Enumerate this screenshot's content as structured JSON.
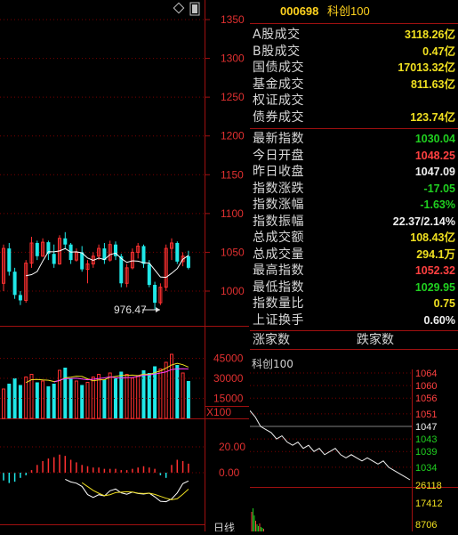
{
  "header": {
    "code": "000698",
    "name": "科创100"
  },
  "stats": [
    {
      "label": "A股成交",
      "value": "3118.26亿",
      "color": "yel"
    },
    {
      "label": "B股成交",
      "value": "0.47亿",
      "color": "yel"
    },
    {
      "label": "国债成交",
      "value": "17013.32亿",
      "color": "yel"
    },
    {
      "label": "基金成交",
      "value": "811.63亿",
      "color": "yel"
    },
    {
      "label": "权证成交",
      "value": "",
      "color": "yel"
    },
    {
      "label": "债券成交",
      "value": "123.74亿",
      "color": "yel"
    }
  ],
  "quote": [
    {
      "label": "最新指数",
      "value": "1030.04",
      "color": "grn"
    },
    {
      "label": "今日开盘",
      "value": "1048.25",
      "color": "red"
    },
    {
      "label": "昨日收盘",
      "value": "1047.09",
      "color": "wht"
    },
    {
      "label": "指数涨跌",
      "value": "-17.05",
      "color": "grn"
    },
    {
      "label": "指数涨幅",
      "value": "-1.63%",
      "color": "grn"
    },
    {
      "label": "指数振幅",
      "value": "22.37/2.14%",
      "color": "wht"
    },
    {
      "label": "总成交额",
      "value": "108.43亿",
      "color": "yel"
    },
    {
      "label": "总成交量",
      "value": "294.1万",
      "color": "yel"
    },
    {
      "label": "最高指数",
      "value": "1052.32",
      "color": "red"
    },
    {
      "label": "最低指数",
      "value": "1029.95",
      "color": "grn"
    },
    {
      "label": "指数量比",
      "value": "0.75",
      "color": "yel"
    },
    {
      "label": "上证换手",
      "value": "0.60%",
      "color": "wht"
    }
  ],
  "updown": {
    "up_label": "涨家数",
    "down_label": "跌家数"
  },
  "mini_chart": {
    "title": "科创100",
    "price_ticks": [
      "1064",
      "1060",
      "1056",
      "1051",
      "1047",
      "1043",
      "1039",
      "1034"
    ],
    "vol_ticks": [
      "26118",
      "17412",
      "8706"
    ]
  },
  "kline": {
    "price_ticks": [
      "1350",
      "1300",
      "1250",
      "1200",
      "1150",
      "1100",
      "1050",
      "1000"
    ],
    "low_label": "976.47",
    "vol_ticks": [
      "45000",
      "30000",
      "15000"
    ],
    "vol_unit": "X100",
    "macd_ticks": [
      "20.00",
      "0.00"
    ],
    "bottom_label": "日线",
    "colors": {
      "up": "#ff3030",
      "down": "#20e8e8",
      "ma5": "#ffffff",
      "ma10": "#f0e020",
      "ma20": "#ff40ff"
    }
  },
  "chart_data": {
    "type": "candlestick",
    "candles": [
      [
        1010,
        1060,
        1000,
        1055
      ],
      [
        1055,
        1062,
        1020,
        1025
      ],
      [
        1025,
        1030,
        990,
        995
      ],
      [
        995,
        1000,
        982,
        988
      ],
      [
        988,
        1040,
        985,
        1036
      ],
      [
        1036,
        1070,
        1030,
        1062
      ],
      [
        1062,
        1065,
        1040,
        1045
      ],
      [
        1045,
        1068,
        1044,
        1063
      ],
      [
        1063,
        1065,
        1040,
        1048
      ],
      [
        1048,
        1060,
        1030,
        1035
      ],
      [
        1035,
        1072,
        1034,
        1068
      ],
      [
        1068,
        1076,
        1055,
        1060
      ],
      [
        1060,
        1062,
        1035,
        1040
      ],
      [
        1040,
        1055,
        1038,
        1050
      ],
      [
        1050,
        1058,
        1025,
        1028
      ],
      [
        1028,
        1040,
        1010,
        1035
      ],
      [
        1035,
        1050,
        1030,
        1045
      ],
      [
        1045,
        1060,
        1040,
        1055
      ],
      [
        1055,
        1062,
        1035,
        1040
      ],
      [
        1040,
        1065,
        1038,
        1060
      ],
      [
        1060,
        1064,
        1040,
        1045
      ],
      [
        1045,
        1048,
        1005,
        1010
      ],
      [
        1010,
        1035,
        1005,
        1030
      ],
      [
        1030,
        1055,
        1028,
        1050
      ],
      [
        1050,
        1062,
        1042,
        1058
      ],
      [
        1058,
        1060,
        1030,
        1035
      ],
      [
        1035,
        1040,
        1005,
        1008
      ],
      [
        1008,
        1012,
        976.47,
        985
      ],
      [
        985,
        1010,
        982,
        1005
      ],
      [
        1005,
        1060,
        1000,
        1055
      ],
      [
        1055,
        1068,
        1040,
        1062
      ],
      [
        1062,
        1064,
        1035,
        1038
      ],
      [
        1038,
        1050,
        1032,
        1045
      ],
      [
        1045,
        1052,
        1028,
        1030
      ]
    ],
    "volumes": [
      22000,
      26000,
      30000,
      25000,
      31000,
      33000,
      27000,
      28000,
      24000,
      26000,
      36000,
      38000,
      30000,
      28000,
      25000,
      27000,
      31000,
      33000,
      29000,
      34000,
      30000,
      35000,
      33000,
      30000,
      32000,
      36000,
      34000,
      39000,
      37000,
      42000,
      48000,
      40000,
      34000,
      28000
    ],
    "macd": [
      -6,
      -8,
      -7,
      -4,
      -2,
      2,
      6,
      9,
      11,
      12,
      14,
      13,
      10,
      8,
      6,
      5,
      4,
      4,
      3,
      3,
      3,
      2,
      2,
      3,
      4,
      5,
      4,
      3,
      -2,
      -4,
      6,
      10,
      9,
      7
    ]
  }
}
